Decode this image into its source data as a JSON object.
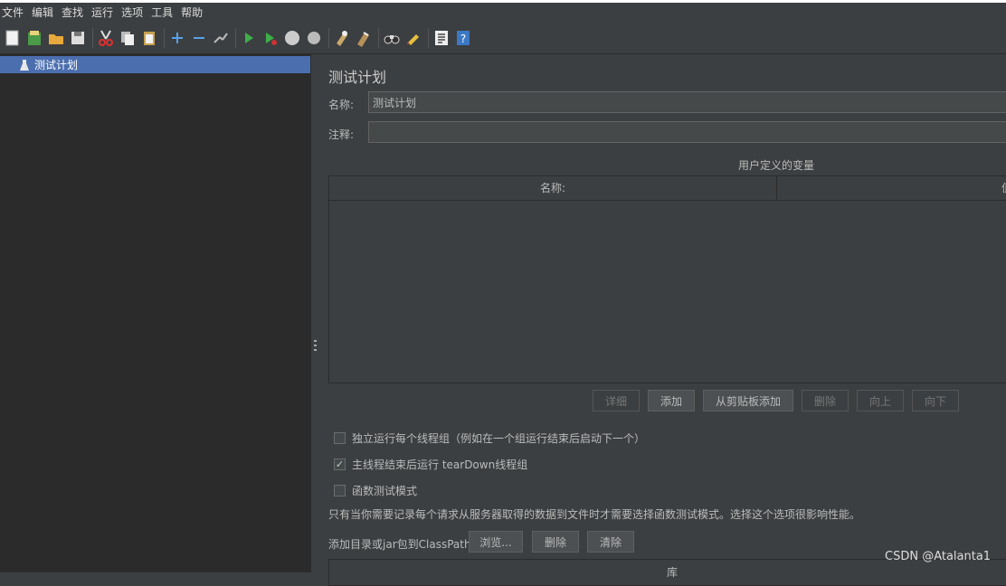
{
  "menu": [
    "文件",
    "编辑",
    "查找",
    "运行",
    "选项",
    "工具",
    "帮助"
  ],
  "toolbar": {
    "icons": [
      "new",
      "templates",
      "open",
      "save",
      "cut",
      "copy",
      "paste",
      "expand",
      "collapse",
      "toggle",
      "start",
      "start-no-pause",
      "stop",
      "shutdown",
      "clear",
      "clear-all",
      "search",
      "reset-search",
      "function-helper",
      "help"
    ]
  },
  "tree": {
    "selected_label": "测试计划"
  },
  "panel": {
    "title": "测试计划",
    "name_label": "名称:",
    "name_value": "测试计划",
    "comment_label": "注释:",
    "comment_value": "",
    "variables_caption": "用户定义的变量",
    "table_headers": [
      "名称:",
      "值"
    ],
    "buttons": {
      "detail": "详细",
      "add": "添加",
      "add_from_clipboard": "从剪贴板添加",
      "delete": "删除",
      "up": "向上",
      "down": "向下"
    },
    "checkboxes": [
      {
        "label": "独立运行每个线程组（例如在一个组运行结束后启动下一个）",
        "checked": false
      },
      {
        "label": "主线程结束后运行 tearDown线程组",
        "checked": true
      },
      {
        "label": "函数测试模式",
        "checked": false
      }
    ],
    "functional_note": "只有当你需要记录每个请求从服务器取得的数据到文件时才需要选择函数测试模式。选择这个选项很影响性能。",
    "classpath_label": "添加目录或jar包到ClassPath",
    "classpath_buttons": {
      "browse": "浏览...",
      "delete": "删除",
      "clear": "清除"
    },
    "library_header": "库"
  },
  "watermark": "CSDN @Atalanta1",
  "colors": {
    "selection": "#4b6eaf",
    "tree_bg": "#2b2b2b",
    "panel_bg": "#3c3f41"
  }
}
